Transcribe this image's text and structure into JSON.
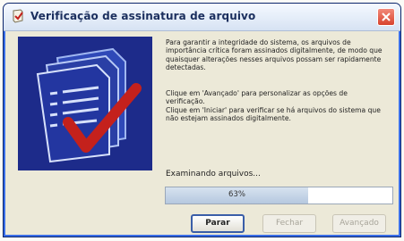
{
  "window": {
    "title": "Verificação de assinatura de arquivo",
    "accent_color": "#0a246a",
    "close_icon": "close-icon"
  },
  "illustration": {
    "icon": "document-check-icon",
    "background_color": "#1d2b8a",
    "check_color": "#c4211c"
  },
  "content": {
    "paragraph1": "Para garantir a integridade do sistema, os arquivos de importância crítica foram assinados digitalmente, de modo que quaisquer alterações nesses arquivos possam ser rapidamente detectadas.",
    "paragraph2_line1": "Clique em 'Avançado' para personalizar as opções de verificação.",
    "paragraph2_line2": "Clique em 'Iniciar' para verificar se há arquivos do sistema que não estejam assinados digitalmente."
  },
  "progress": {
    "label": "Examinando arquivos...",
    "percent_text": "63%",
    "value": 0.63
  },
  "buttons": {
    "stop": "Parar",
    "close": "Fechar",
    "advanced": "Avançado"
  }
}
